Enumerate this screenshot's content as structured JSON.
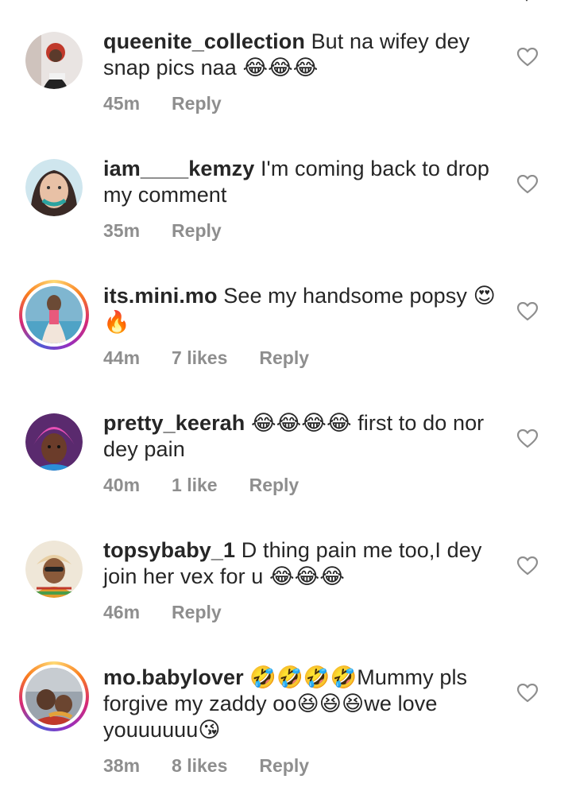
{
  "comments": [
    {
      "username": "queenite_collection",
      "text": " But na wifey dey snap pics naa 😂😂😂",
      "time": "45m",
      "likes": "",
      "reply": "Reply",
      "avatar_color": "#c9a9a0"
    },
    {
      "username": "iam____kemzy",
      "text": " I'm coming back to drop my comment",
      "time": "35m",
      "likes": "",
      "reply": "Reply",
      "avatar_color": "#b9d6e4"
    },
    {
      "username": "its.mini.mo",
      "text": " See my handsome popsy 😍🔥",
      "time": "44m",
      "likes": "7 likes",
      "reply": "Reply",
      "avatar_color": "#8fb3c8"
    },
    {
      "username": "pretty_keerah",
      "text": " 😂😂😂😂 first to do nor dey pain",
      "time": "40m",
      "likes": "1 like",
      "reply": "Reply",
      "avatar_color": "#c55db3"
    },
    {
      "username": "topsybaby_1",
      "text": " D thing pain me too,I dey join her vex for u 😂😂😂",
      "time": "46m",
      "likes": "",
      "reply": "Reply",
      "avatar_color": "#d6b07a"
    },
    {
      "username": "mo.babylover",
      "text": " 🤣🤣🤣🤣Mummy pls forgive my zaddy oo😆😆😆we love youuuuuu😘",
      "time": "38m",
      "likes": "8 likes",
      "reply": "Reply",
      "avatar_color": "#6a7a8a"
    }
  ],
  "colors": {
    "text": "#262626",
    "meta": "#8e8e8e",
    "heart_stroke": "#8e8e8e"
  },
  "icons": {
    "heart": "heart-outline-icon",
    "story_ring": "story-ring"
  }
}
